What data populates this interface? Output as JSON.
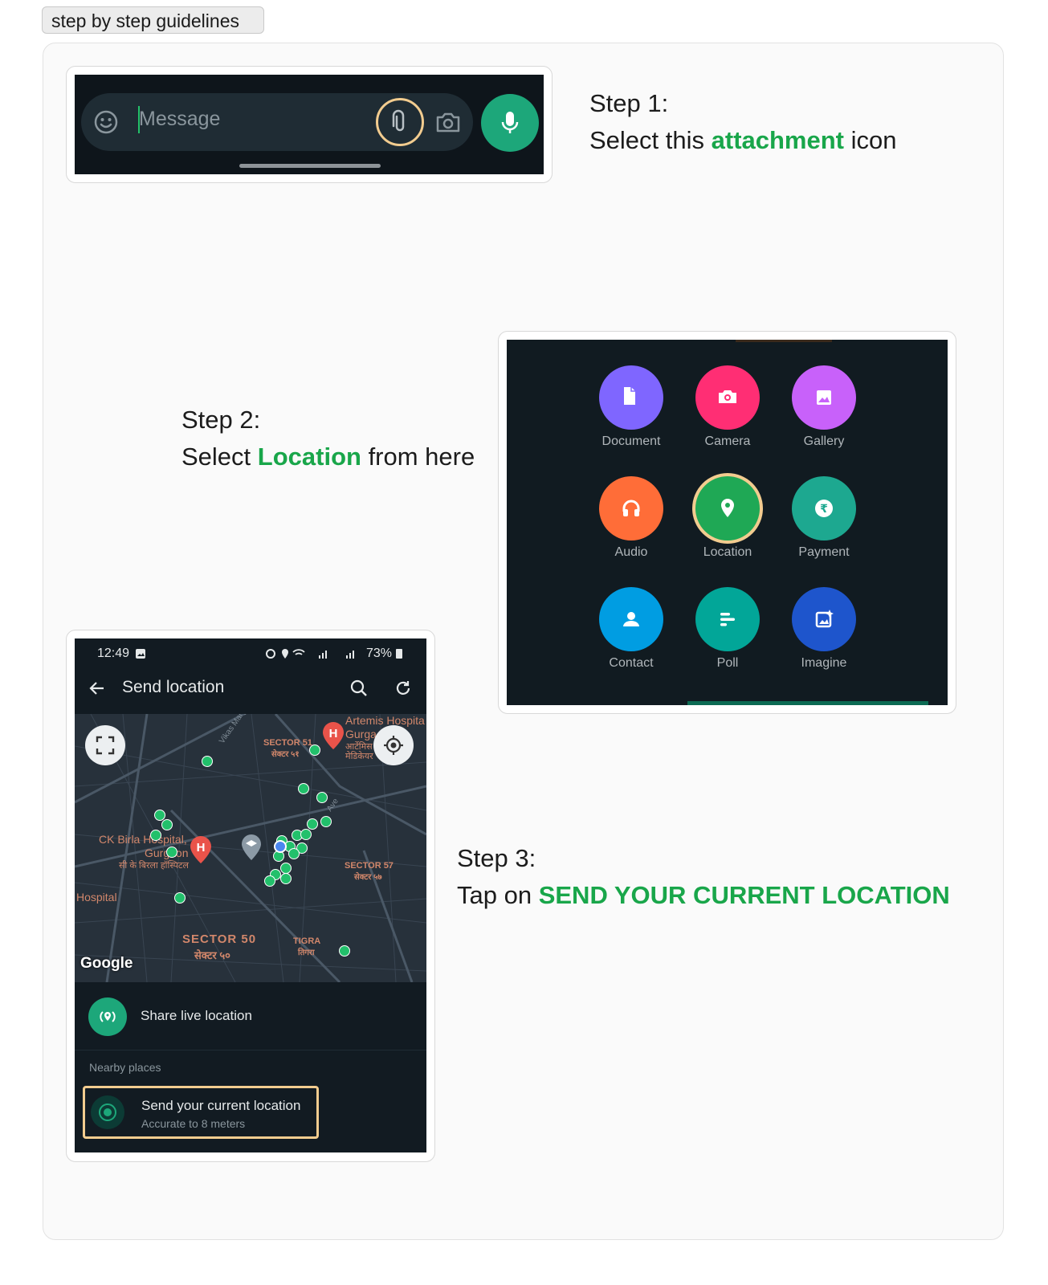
{
  "tag_label": "step by step guidelines",
  "step1": {
    "title": "Step 1:",
    "line_pre": "Select this ",
    "highlight": "attachment",
    "line_post": " icon",
    "message_placeholder": "Message",
    "icons": [
      "emoji-icon",
      "attachment-icon",
      "camera-icon",
      "mic-icon"
    ]
  },
  "step2": {
    "title": "Step 2:",
    "line_pre": "Select ",
    "highlight": "Location",
    "line_post": " from here",
    "attachments": [
      {
        "label": "Document",
        "color": "#7f66ff",
        "icon": "document-icon"
      },
      {
        "label": "Camera",
        "color": "#ff2e74",
        "icon": "camera-icon"
      },
      {
        "label": "Gallery",
        "color": "#c861fa",
        "icon": "gallery-icon"
      },
      {
        "label": "Audio",
        "color": "#ff6d38",
        "icon": "headphones-icon"
      },
      {
        "label": "Location",
        "color": "#1fa855",
        "icon": "location-pin-icon"
      },
      {
        "label": "Payment",
        "color": "#1da890",
        "icon": "rupee-icon"
      },
      {
        "label": "Contact",
        "color": "#009de2",
        "icon": "contact-icon"
      },
      {
        "label": "Poll",
        "color": "#02a698",
        "icon": "poll-icon"
      },
      {
        "label": "Imagine",
        "color": "#1e55cc",
        "icon": "imagine-icon"
      }
    ]
  },
  "step3": {
    "title": "Step 3:",
    "line_pre": "Tap on ",
    "highlight": "SEND YOUR CURRENT LOCATION",
    "phone": {
      "time": "12:49",
      "battery": "73%",
      "header_title": "Send location",
      "map_labels": {
        "artemis": "Artemis Hospita",
        "gurga": "Gurga",
        "artemis_hi": "आर्टेमिस",
        "medicare": "मेडिकेयर",
        "sector51": "SECTOR 51",
        "sector51_hi": "सेक्टर ५१",
        "ckbirla": "CK Birla Hospital,",
        "gurgaon": "Gurgaon",
        "ckbirla_hi": "सी के बिरला हॉस्पिटल",
        "hospital": "Hospital",
        "sector57": "SECTOR 57",
        "sector57_hi": "सेक्टर ५७",
        "sector50": "SECTOR 50",
        "sector50_hi": "सेक्टर ५०",
        "tigra": "TIGRA",
        "tigra_hi": "तिगरा",
        "vikas": "Vikas Marg",
        "ave": "Ave",
        "google": "Google"
      },
      "share_live": "Share live location",
      "nearby": "Nearby places",
      "send_current": "Send your current location",
      "accuracy": "Accurate to 8 meters"
    }
  },
  "colors": {
    "highlight_green": "#19a64a",
    "ring": "#f2cc8f",
    "whatsapp_green": "#1da77a"
  }
}
